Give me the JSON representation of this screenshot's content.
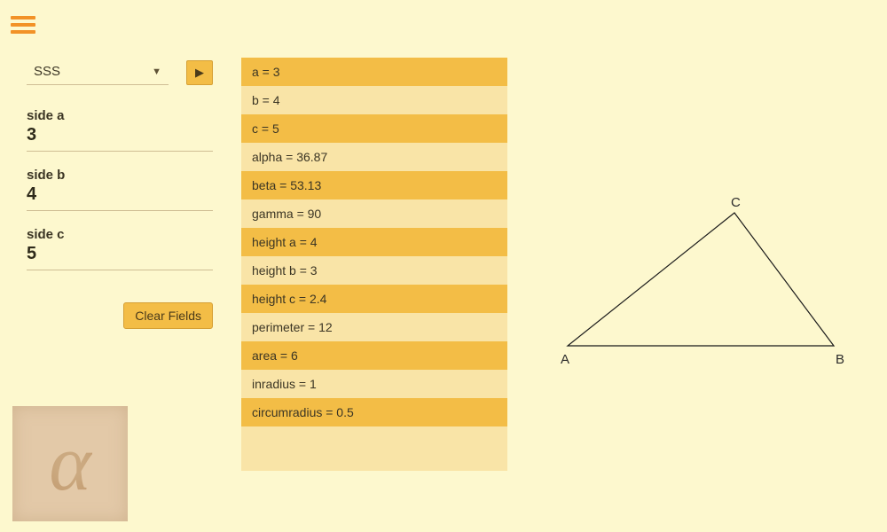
{
  "mode": {
    "selected": "SSS"
  },
  "run_button_glyph": "▶",
  "fields": {
    "a": {
      "label": "side a",
      "value": "3"
    },
    "b": {
      "label": "side b",
      "value": "4"
    },
    "c": {
      "label": "side c",
      "value": "5"
    }
  },
  "clear_label": "Clear Fields",
  "results": [
    "a = 3",
    "b = 4",
    "c = 5",
    "alpha = 36.87",
    "beta = 53.13",
    "gamma = 90",
    "height a = 4",
    "height b = 3",
    "height c = 2.4",
    "perimeter = 12",
    "area = 6",
    "inradius = 1",
    "circumradius = 0.5"
  ],
  "vertices": {
    "A": "A",
    "B": "B",
    "C": "C"
  },
  "alpha_glyph": "α"
}
